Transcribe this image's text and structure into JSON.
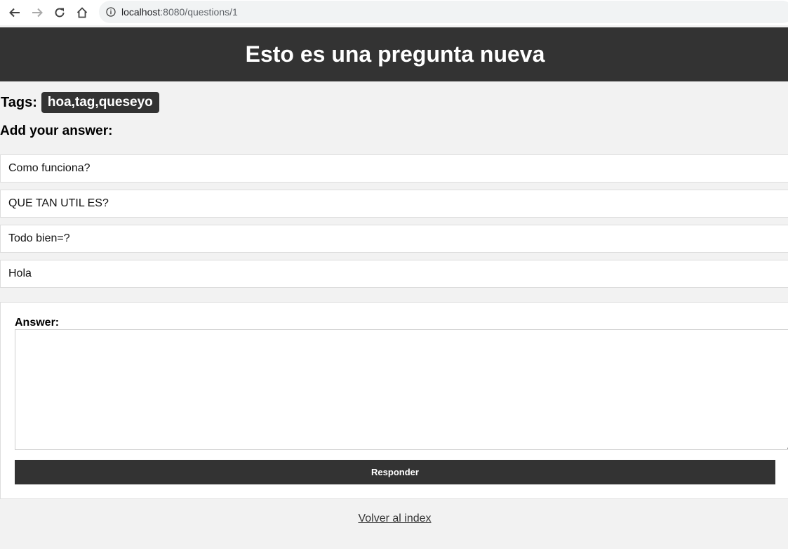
{
  "browser": {
    "url_host": "localhost",
    "url_rest": ":8080/questions/1"
  },
  "header": {
    "title": "Esto es una pregunta nueva"
  },
  "tags": {
    "label": "Tags:",
    "value": "hoa,tag,queseyo"
  },
  "answers_heading": "Add your answer:",
  "answers": [
    "Como funciona?",
    "QUE TAN UTIL ES?",
    "Todo bien=?",
    "Hola"
  ],
  "form": {
    "label": "Answer:",
    "textarea_value": "",
    "submit_label": "Responder"
  },
  "footer": {
    "back_link": "Volver al index"
  },
  "colors": {
    "header_bg": "#333333",
    "page_bg": "#f2f2f2"
  }
}
